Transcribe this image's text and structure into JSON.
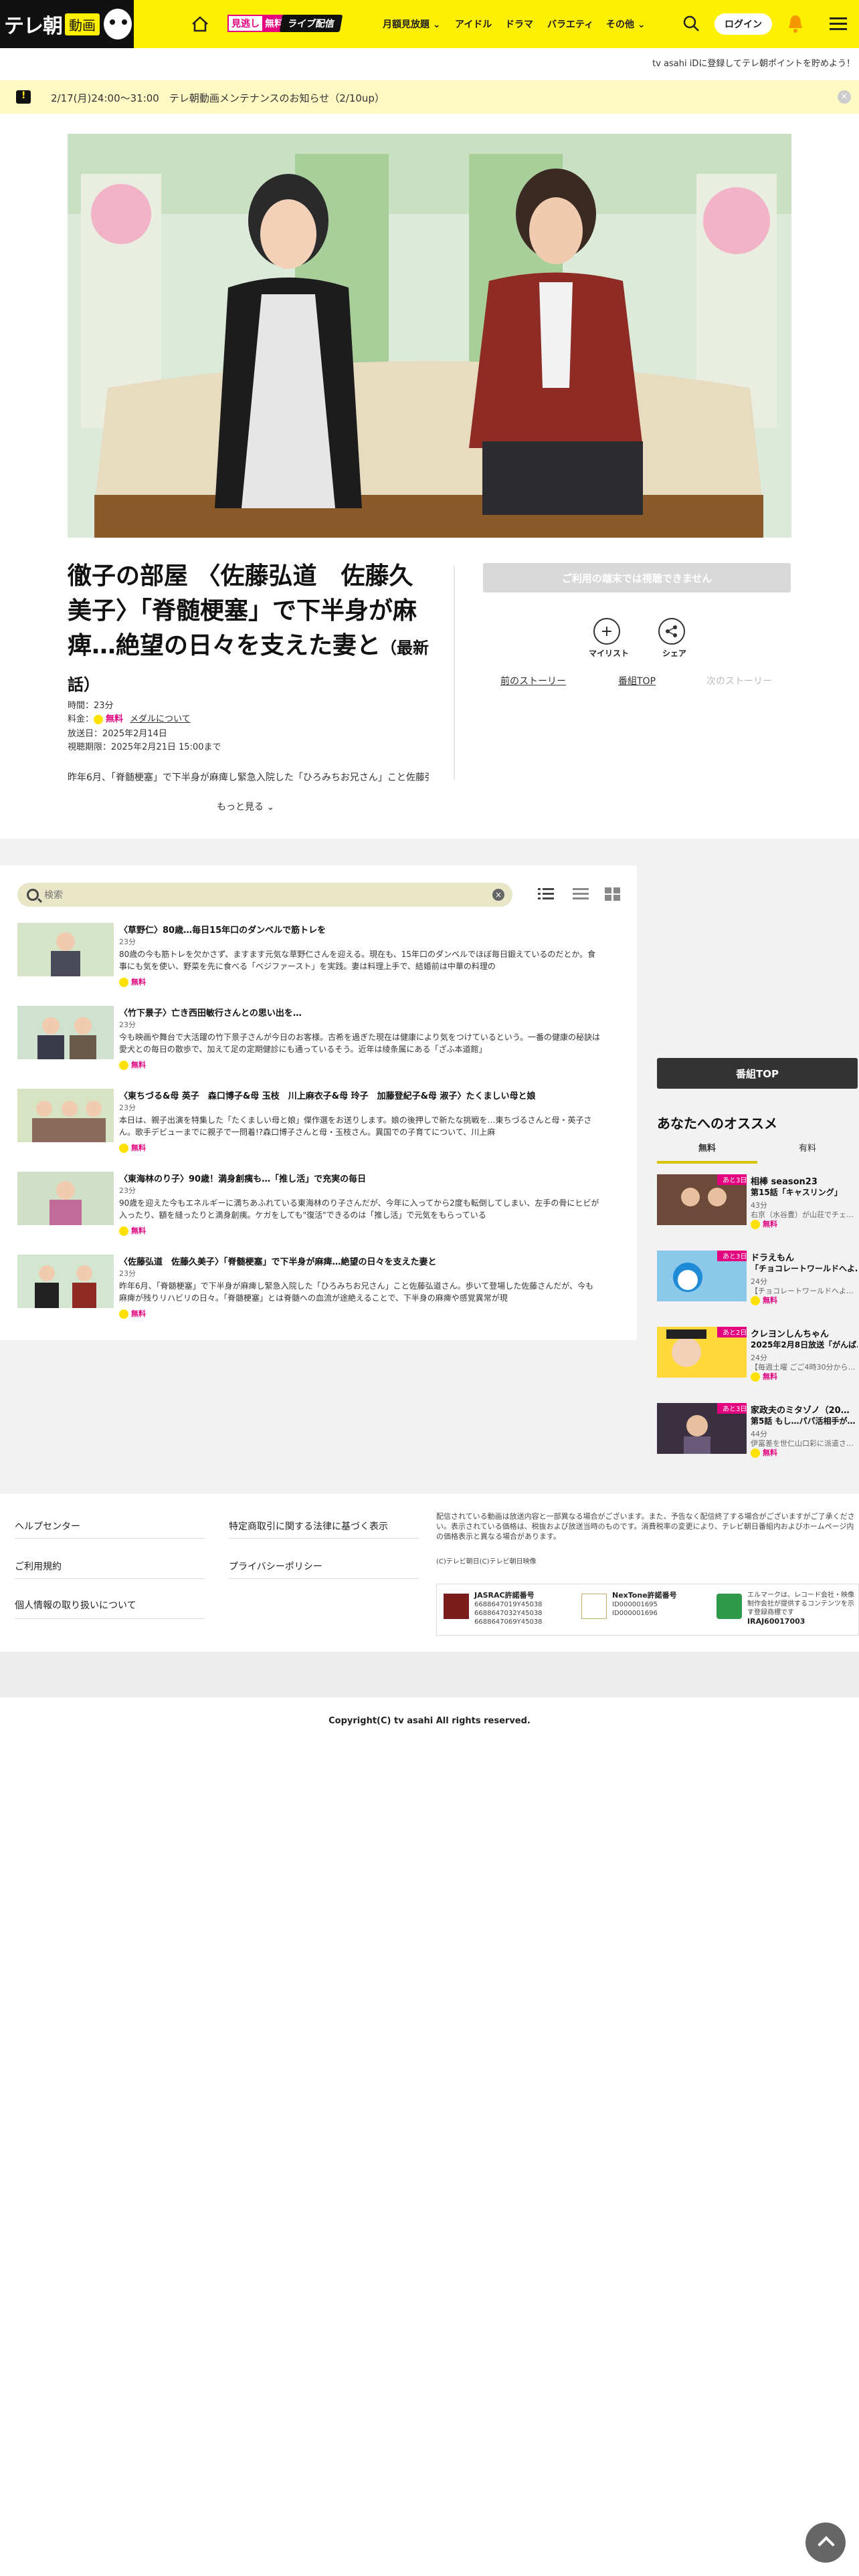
{
  "header": {
    "logo_text": "テレ朝",
    "logo_badge": "動画",
    "mitoshi_a": "見逃し",
    "mitoshi_b": "無料",
    "live_label": "ライブ配信",
    "nav": [
      "月額見放題",
      "アイドル",
      "ドラマ",
      "バラエティ",
      "その他"
    ],
    "login": "ログイン"
  },
  "promo_line": "tv asahi iDに登録してテレ朝ポイントを貯めよう！",
  "notice": {
    "text": "2/17(月)24:00～31:00　テレ朝動画メンテナンスのお知らせ（2/10up）",
    "close": "×"
  },
  "episode": {
    "title": "徹子の部屋 〈佐藤弘道　佐藤久美子〉「脊髄梗塞」で下半身が麻痺…絶望の日々を支えた妻と",
    "latest": "（最新話）",
    "duration": "時間：23分",
    "price_label": "料金：",
    "price_free": "無料",
    "media_link": "メダルについて",
    "aired": "放送日：2025年2月14日",
    "deadline": "視聴期限：2025年2月21日 15:00まで",
    "description": "昨年6月、「脊髄梗塞」で下半身が麻痺し緊急入院した「ひろみちお兄さん」こと佐藤弘道さ",
    "more": "もっと見る"
  },
  "actions": {
    "disabled": "ご利用の端末では視聴できません",
    "mylist": "マイリスト",
    "share": "シェア",
    "prev": "前のストーリー",
    "top": "番組TOP",
    "next": "次のストーリー"
  },
  "search": {
    "placeholder": "検索",
    "clear": "×"
  },
  "episodes": [
    {
      "title": "〈草野仁〉80歳…毎日15年口のダンベルで筋トレを",
      "duration": "23分",
      "desc": "80歳の今も筋トレを欠かさず、ますます元気な草野仁さんを迎える。現在も、15年口のダンベルでほぼ毎日鍛えているのだとか。食事にも気を使い、野菜を先に食べる「ベジファースト」を実践。妻は料理上手で、結婚前は中華の料理の",
      "free": "無料"
    },
    {
      "title": "〈竹下景子〉亡き西田敏行さんとの思い出を…",
      "duration": "23分",
      "desc": "今も映画や舞台で大活躍の竹下景子さんが今日のお客様。古希を過ぎた現在は健康により気をつけているという。一番の健康の秘訣は愛犬との毎日の散歩で、加えて足の定期健診にも通っているそう。近年は绫条属にある「ざふ本道館」",
      "free": "無料"
    },
    {
      "title": "〈東ちづる&母 英子　森口博子&母 玉枝　川上麻衣子&母 玲子　加藤登紀子&母 淑子〉たくましい母と娘",
      "duration": "23分",
      "desc": "本日は、親子出演を特集した「たくましい母と娘」傑作選をお送りします。娘の後押しで新たな挑戦を…東ちづるさんと母・英子さん。歌手デビューまでに親子で一問着!?森口博子さんと母・玉枝さん。異国での子育てについて、川上麻",
      "free": "無料"
    },
    {
      "title": "〈東海林のり子〉90歳！満身創痍も…「推し活」で充実の毎日",
      "duration": "23分",
      "desc": "90歳を迎えた今もエネルギーに満ちあふれている東海林のり子さんだが、今年に入ってから2度も転倒してしまい、左手の骨にヒビが入ったり、額を縫ったりと満身創痍。ケガをしても\"復活\"できるのは「推し活」で元気をもらっている",
      "free": "無料"
    },
    {
      "title": "〈佐藤弘道　佐藤久美子〉「脊髄梗塞」で下半身が麻痺…絶望の日々を支えた妻と",
      "duration": "23分",
      "desc": "昨年6月、「脊髄梗塞」で下半身が麻痺し緊急入院した「ひろみちお兄さん」こと佐藤弘道さん。歩いて登場した佐藤さんだが、今も麻痺が残りリハビリの日々。「脊髄梗塞」とは脊髄への血流が途絶えることで、下半身の麻痺や感覚異常が現",
      "free": "無料"
    }
  ],
  "sidebar": {
    "top_button": "番組TOP",
    "heading": "あなたへのオススメ",
    "tab_free": "無料",
    "tab_paid": "有料",
    "items": [
      {
        "name": "相棒 season23",
        "sub": "第15話「キャスリング」",
        "duration": "43分",
        "extra": "右京（水谷豊）が山荘でチェ…",
        "free": "無料",
        "badge": "あと3日"
      },
      {
        "name": "ドラえもん",
        "sub": "「チョコレートワールドへよ…",
        "duration": "24分",
        "extra": "【チョコレートワールドへよ…",
        "free": "無料",
        "badge": "あと3日"
      },
      {
        "name": "クレヨンしんちゃん",
        "sub": "2025年2月8日放送「がんば…",
        "duration": "24分",
        "extra": "【毎週土曜 ごご4時30分から…",
        "free": "無料",
        "badge": "あと2日"
      },
      {
        "name": "家政夫のミタゾノ（20…",
        "sub": "第5話 もし…パパ活相手が…",
        "duration": "44分",
        "extra": "伊冨差を世仁山口彩に派遣さ…",
        "free": "無料",
        "badge": "あと3日"
      }
    ]
  },
  "footer": {
    "links_left": [
      "ヘルプセンター",
      "ご利用規約",
      "個人情報の取り扱いについて"
    ],
    "links_right": [
      "特定商取引に関する法律に基づく表示",
      "プライバシーポリシー"
    ],
    "note": "配信されている動画は放送内容と一部異なる場合がございます。また、予告なく配信終了する場合がございますがご了承ください。表示されている価格は、税抜および放送当時のものです。消費税率の変更により、テレビ朝日番組内およびホームページ内の価格表示と異なる場合があります。",
    "small": "(C)テレビ朝日(C)テレビ朝日映像",
    "jasrac_label": "JASRAC許諾番号",
    "jasrac_nums": [
      "6688647019Y45038",
      "6688647032Y45038",
      "6688647069Y45038"
    ],
    "nextone_label": "NexTone許諾番号",
    "nextone_nums": [
      "ID000001695",
      "ID000001696"
    ],
    "lmark_text": "エルマークは、レコード会社・映像制作会社が提供するコンテンツを示す登録商標です",
    "lmark_code": "IRAJ60017003",
    "copyright": "Copyright(C) tv asahi All rights reserved."
  }
}
